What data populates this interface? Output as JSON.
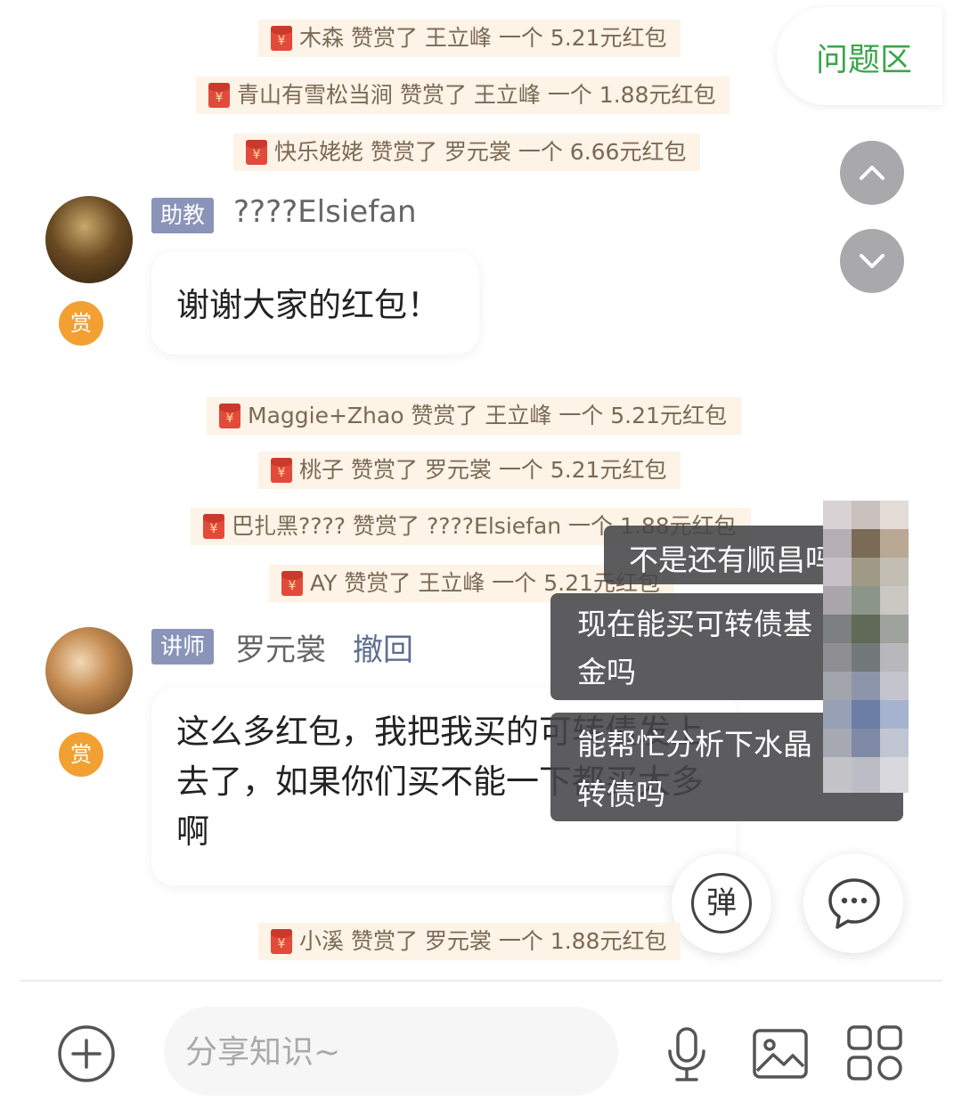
{
  "question_tab": {
    "label": "问题区"
  },
  "notices": [
    {
      "text": "木森 赞赏了 王立峰 一个 5.21元红包"
    },
    {
      "text": "青山有雪松当涧 赞赏了 王立峰 一个 1.88元红包"
    },
    {
      "text": "快乐姥姥 赞赏了 罗元裳 一个 6.66元红包"
    },
    {
      "text": "Maggie+Zhao 赞赏了 王立峰 一个 5.21元红包"
    },
    {
      "text": "桃子 赞赏了 罗元裳 一个 5.21元红包"
    },
    {
      "text": "巴扎黑???? 赞赏了 ????Elsiefan 一个 1.88元红包"
    },
    {
      "text": "AY 赞赏了 王立峰 一个 5.21元红包"
    },
    {
      "text": "小溪 赞赏了 罗元裳 一个 1.88元红包"
    }
  ],
  "messages": [
    {
      "role": "助教",
      "sender": "????Elsiefan",
      "reward": "赏",
      "text": "谢谢大家的红包！"
    },
    {
      "role": "讲师",
      "sender": "罗元裳",
      "action": "撤回",
      "reward": "赏",
      "lines": [
        "这么多红包，我把我买的可转债发上",
        "去了，如果你们买不能一下都买太多",
        "啊"
      ]
    }
  ],
  "danmaku": [
    {
      "text": "不是还有顺昌吗"
    },
    {
      "lines": [
        "现在能买可转债基",
        "金吗"
      ]
    },
    {
      "lines": [
        "能帮忙分析下水晶",
        "转债吗"
      ]
    }
  ],
  "float_buttons": {
    "danmaku_toggle": "弹"
  },
  "input": {
    "placeholder": "分享知识~"
  },
  "colors": {
    "accent_green": "#3aa649",
    "notice_bg": "#fdf3e6",
    "reward_orange": "#f1a031"
  }
}
